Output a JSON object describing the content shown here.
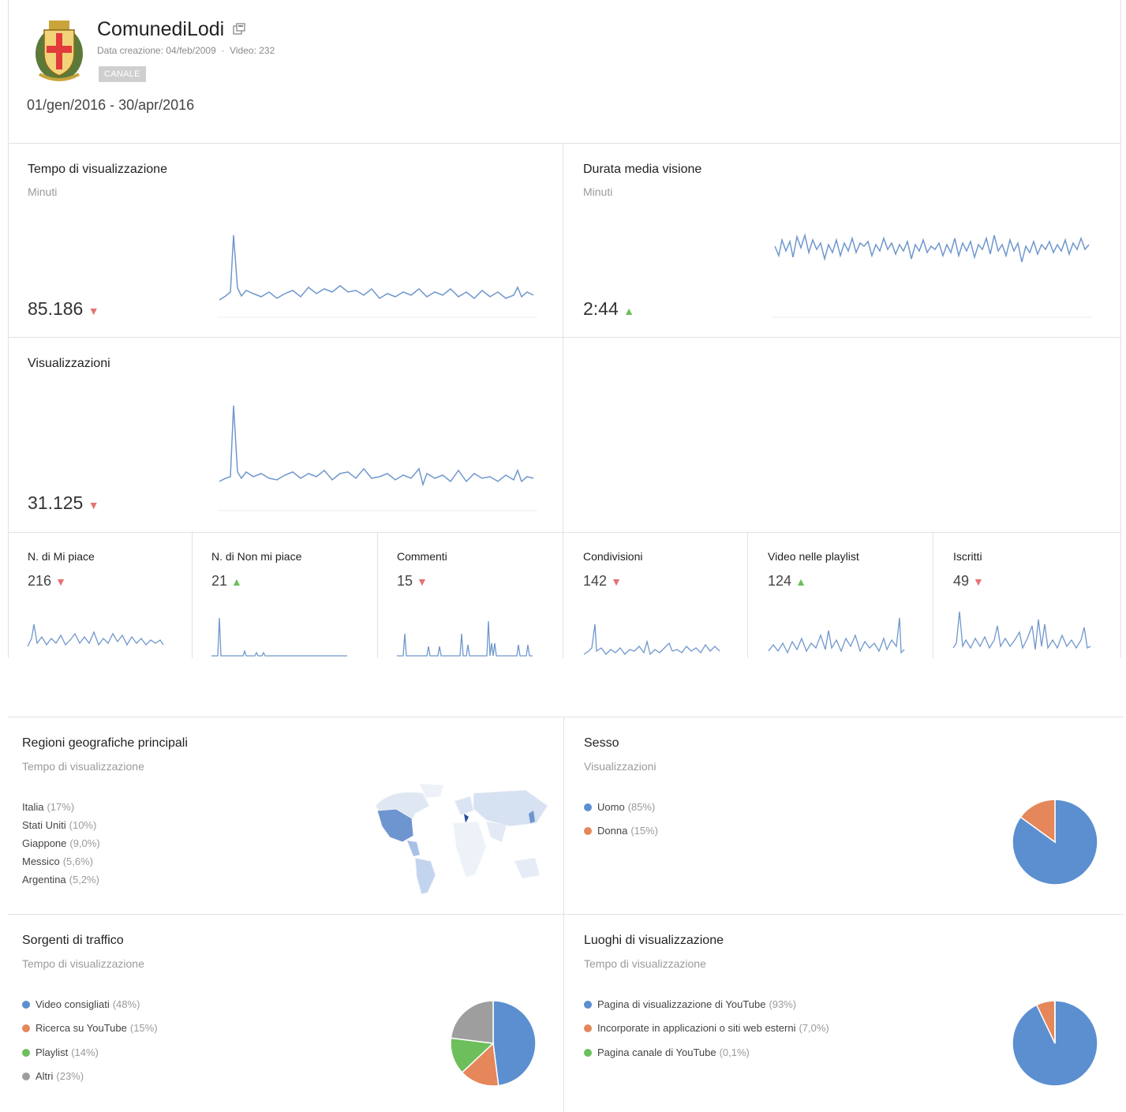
{
  "header": {
    "channel_name": "ComunediLodi",
    "meta": "Data creazione: 04/feb/2009  ·  Video: 232",
    "badge": "CANALE",
    "date_range": "01/gen/2016 - 30/apr/2016",
    "icons": {
      "logo": "coat-of-arms-logo",
      "external": "external-link-icon"
    }
  },
  "colors": {
    "line": "#6f97cc",
    "down": "#e57373",
    "up": "#6cbf5a",
    "blue": "#5b8fd0",
    "orange": "#e5875a",
    "green": "#6cbf5a",
    "gray": "#9e9e9e"
  },
  "metrics": {
    "watch_time": {
      "title": "Tempo di visualizzazione",
      "sub": "Minuti",
      "value": "85.186",
      "trend": "down"
    },
    "avg_duration": {
      "title": "Durata media visione",
      "sub": "Minuti",
      "value": "2:44",
      "trend": "up"
    },
    "views": {
      "title": "Visualizzazioni",
      "value": "31.125",
      "trend": "down"
    }
  },
  "small_metrics": [
    {
      "title": "N. di Mi piace",
      "value": "216",
      "trend": "down"
    },
    {
      "title": "N. di Non mi piace",
      "value": "21",
      "trend": "up"
    },
    {
      "title": "Commenti",
      "value": "15",
      "trend": "down"
    },
    {
      "title": "Condivisioni",
      "value": "142",
      "trend": "down"
    },
    {
      "title": "Video nelle playlist",
      "value": "124",
      "trend": "up"
    },
    {
      "title": "Iscritti",
      "value": "49",
      "trend": "down"
    }
  ],
  "regions": {
    "title": "Regioni geografiche principali",
    "sub": "Tempo di visualizzazione",
    "items": [
      {
        "name": "Italia",
        "pct": "(17%)"
      },
      {
        "name": "Stati Uniti",
        "pct": "(10%)"
      },
      {
        "name": "Giappone",
        "pct": "(9,0%)"
      },
      {
        "name": "Messico",
        "pct": "(5,6%)"
      },
      {
        "name": "Argentina",
        "pct": "(5,2%)"
      }
    ]
  },
  "gender": {
    "title": "Sesso",
    "sub": "Visualizzazioni",
    "items": [
      {
        "name": "Uomo",
        "pct": "(85%)",
        "color": "#5b8fd0"
      },
      {
        "name": "Donna",
        "pct": "(15%)",
        "color": "#e5875a"
      }
    ]
  },
  "traffic": {
    "title": "Sorgenti di traffico",
    "sub": "Tempo di visualizzazione",
    "items": [
      {
        "name": "Video consigliati",
        "pct": "(48%)",
        "color": "#5b8fd0"
      },
      {
        "name": "Ricerca su YouTube",
        "pct": "(15%)",
        "color": "#e5875a"
      },
      {
        "name": "Playlist",
        "pct": "(14%)",
        "color": "#6cbf5a"
      },
      {
        "name": "Altri",
        "pct": "(23%)",
        "color": "#9e9e9e"
      }
    ]
  },
  "places": {
    "title": "Luoghi di visualizzazione",
    "sub": "Tempo di visualizzazione",
    "items": [
      {
        "name": "Pagina di visualizzazione di YouTube",
        "pct": "(93%)",
        "color": "#5b8fd0"
      },
      {
        "name": "Incorporate in applicazioni o siti web esterni",
        "pct": "(7,0%)",
        "color": "#e5875a"
      },
      {
        "name": "Pagina canale di YouTube",
        "pct": "(0,1%)",
        "color": "#6cbf5a"
      }
    ]
  },
  "chart_data": [
    {
      "type": "pie",
      "labels": [
        "Uomo",
        "Donna"
      ],
      "values": [
        85,
        15
      ]
    },
    {
      "type": "pie",
      "labels": [
        "Video consigliati",
        "Ricerca su YouTube",
        "Playlist",
        "Altri"
      ],
      "values": [
        48,
        15,
        14,
        23
      ]
    },
    {
      "type": "pie",
      "labels": [
        "Pagina di visualizzazione di YouTube",
        "Incorporate in applicazioni o siti web esterni",
        "Pagina canale di YouTube"
      ],
      "values": [
        93,
        7.0,
        0.1
      ]
    }
  ]
}
